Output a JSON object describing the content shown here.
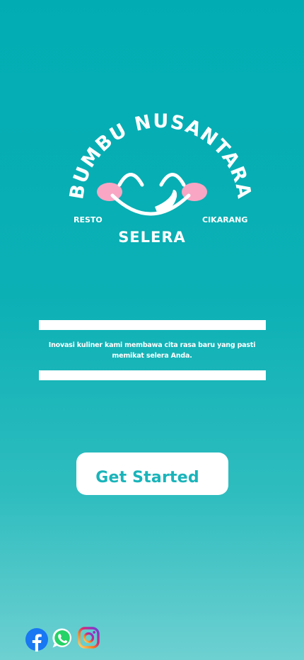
{
  "brand": {
    "arc_text": "BUMBU NUSANTARA",
    "left_text": "RESTO",
    "right_text": "CIKARANG",
    "bottom_text": "SELERA",
    "logo_color": "#ffffff",
    "cheek_color": "#f8a6c4"
  },
  "tagline": "Inovasi kuliner kami membawa cita rasa baru yang pasti memikat selera Anda.",
  "cta": {
    "label": "Get Started"
  },
  "social": [
    {
      "name": "facebook",
      "icon": "facebook-icon"
    },
    {
      "name": "whatsapp",
      "icon": "whatsapp-icon"
    },
    {
      "name": "instagram",
      "icon": "instagram-icon"
    }
  ],
  "colors": {
    "background_top": "#01adb3",
    "background_bottom": "#6ed0d1",
    "accent": "#19b4ba",
    "facebook": "#1877f2",
    "whatsapp": "#25d366"
  }
}
